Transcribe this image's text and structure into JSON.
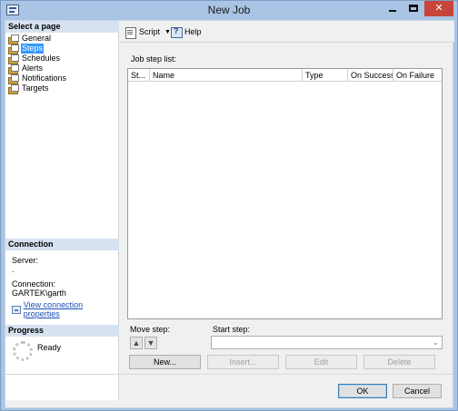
{
  "window": {
    "title": "New Job",
    "close_glyph": "✕"
  },
  "select_page": {
    "header": "Select a page",
    "items": [
      {
        "label": "General",
        "icon": "page-settings-icon",
        "selected": false
      },
      {
        "label": "Steps",
        "icon": "page-settings-icon",
        "selected": true
      },
      {
        "label": "Schedules",
        "icon": "page-settings-icon",
        "selected": false
      },
      {
        "label": "Alerts",
        "icon": "page-settings-icon",
        "selected": false
      },
      {
        "label": "Notifications",
        "icon": "page-settings-icon",
        "selected": false
      },
      {
        "label": "Targets",
        "icon": "page-settings-icon",
        "selected": false
      }
    ]
  },
  "connection": {
    "header": "Connection",
    "server_label": "Server:",
    "server_value": ".",
    "connection_label": "Connection:",
    "connection_value": "GARTEK\\garth",
    "view_properties_link": "View connection properties"
  },
  "progress": {
    "header": "Progress",
    "status": "Ready"
  },
  "toolbar": {
    "script_label": "Script",
    "help_label": "Help"
  },
  "steps": {
    "list_label": "Job step list:",
    "columns": [
      "St...",
      "Name",
      "Type",
      "On Success",
      "On Failure"
    ],
    "rows": [],
    "move_step_label": "Move step:",
    "start_step_label": "Start step:",
    "start_step_value": "",
    "buttons": {
      "new": "New...",
      "insert": "Insert...",
      "edit": "Edit",
      "delete": "Delete"
    }
  },
  "dialog_buttons": {
    "ok": "OK",
    "cancel": "Cancel"
  },
  "colors": {
    "title_bar": "#a9c4e4",
    "close_button": "#c7453a",
    "selected_item": "#3399ff",
    "section_header": "#d6e2f0",
    "link": "#1a4fb5"
  }
}
